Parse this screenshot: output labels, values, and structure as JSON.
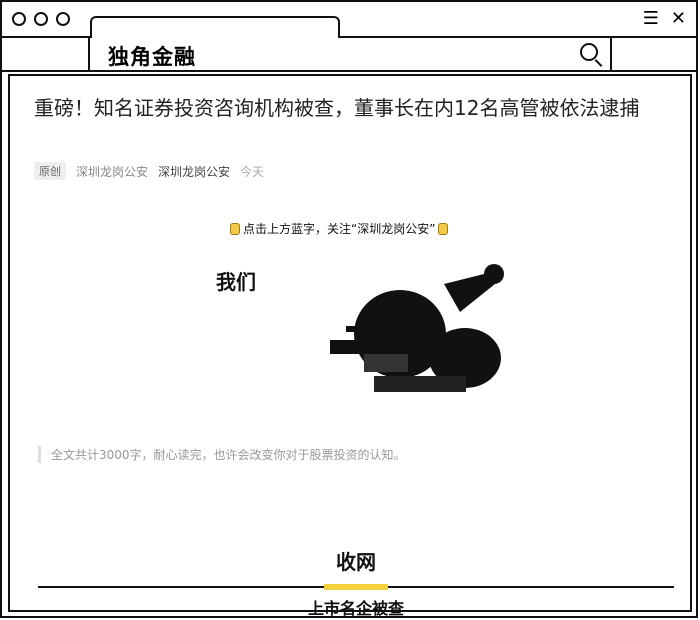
{
  "window": {
    "brand": "独角金融"
  },
  "article": {
    "headline": "重磅！知名证券投资咨询机构被查，董事长在内12名高管被依法逮捕",
    "meta": {
      "badge": "原创",
      "source": "深圳龙岗公安",
      "author": "深圳龙岗公安",
      "time": "今天"
    },
    "follow_prompt": "点击上方蓝字，关注“深圳龙岗公安”",
    "illustration_text": "我们",
    "quote": "全文共计3000字，耐心读完，也许会改变你对于股票投资的认知。",
    "section": {
      "title": "收网",
      "subtitle": "上市名企被查"
    }
  },
  "colors": {
    "accent": "#f3d13a",
    "text": "#222222",
    "muted": "#999999"
  }
}
